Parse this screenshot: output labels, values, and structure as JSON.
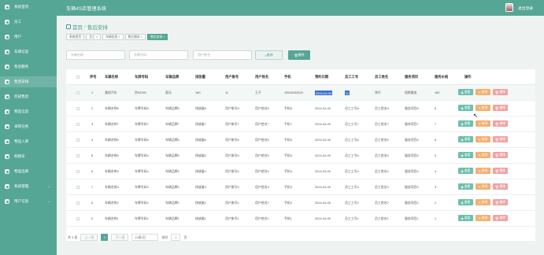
{
  "app": {
    "title": "车辆4S店管理系统",
    "logout": "退出登录"
  },
  "sidebar": {
    "items": [
      {
        "label": "系统首页"
      },
      {
        "label": "员工"
      },
      {
        "label": "用户"
      },
      {
        "label": "车辆信息"
      },
      {
        "label": "售后服务"
      },
      {
        "label": "售后安排"
      },
      {
        "label": "完成售后"
      },
      {
        "label": "物品信息"
      },
      {
        "label": "采购任务"
      },
      {
        "label": "物品入库"
      },
      {
        "label": "购物车"
      },
      {
        "label": "物品出库"
      },
      {
        "label": "系统管理"
      },
      {
        "label": "用户信息"
      }
    ],
    "active_index": 5
  },
  "page": {
    "breadcrumb_home": "首页",
    "breadcrumb_sep": "/",
    "breadcrumb_current": "售后安排",
    "tabs": [
      {
        "label": "系统首页"
      },
      {
        "label": "员工 ×"
      },
      {
        "label": "车辆信息 ×"
      },
      {
        "label": "售后服务 ×"
      },
      {
        "label": "售后安排 ×"
      }
    ]
  },
  "search": {
    "vehicle_name_placeholder": "车辆名称",
    "vehicle_no_placeholder": "车牌号码",
    "user_name_placeholder": "用户姓名",
    "search_label": "查询",
    "delete_label": "删除"
  },
  "table": {
    "headers": [
      "序号",
      "车辆名称",
      "车牌号码",
      "车辆品牌",
      "排放量",
      "用户账号",
      "用户姓名",
      "手机",
      "预约日期",
      "员工工号",
      "员工姓名",
      "服务项目",
      "服务价格",
      "操作"
    ],
    "rows": [
      [
        "1",
        "我的汽车",
        "京52255",
        "奥马",
        "180",
        "11",
        "王子",
        "13525252525",
        "2024-04-09",
        "11",
        "李仔",
        "保养服务",
        "180"
      ],
      [
        "2",
        "车辆名称8",
        "车牌号码8",
        "车辆品牌8",
        "排放量8",
        "用户账号8",
        "用户姓名8",
        "手机8",
        "2024-04-09",
        "员工工号8",
        "员工姓名8",
        "服务项目8",
        "8"
      ],
      [
        "3",
        "车辆名称7",
        "车牌号码7",
        "车辆品牌7",
        "排放量7",
        "用户账号7",
        "用户姓名7",
        "手机7",
        "2024-04-09",
        "员工工号7",
        "员工姓名7",
        "服务项目7",
        "7"
      ],
      [
        "4",
        "车辆名称6",
        "车牌号码6",
        "车辆品牌6",
        "排放量6",
        "用户账号6",
        "用户姓名6",
        "手机6",
        "2024-04-09",
        "员工工号6",
        "员工姓名6",
        "服务项目6",
        "6"
      ],
      [
        "5",
        "车辆名称5",
        "车牌号码5",
        "车辆品牌5",
        "排放量5",
        "用户账号5",
        "用户姓名5",
        "手机5",
        "2024-04-09",
        "员工工号5",
        "员工姓名5",
        "服务项目5",
        "5"
      ],
      [
        "6",
        "车辆名称4",
        "车牌号码4",
        "车辆品牌4",
        "排放量4",
        "用户账号4",
        "用户姓名4",
        "手机4",
        "2024-04-09",
        "员工工号4",
        "员工姓名4",
        "服务项目4",
        "4"
      ],
      [
        "7",
        "车辆名称3",
        "车牌号码3",
        "车辆品牌3",
        "排放量3",
        "用户账号3",
        "用户姓名3",
        "手机3",
        "2024-04-09",
        "员工工号3",
        "员工姓名3",
        "服务项目3",
        "3"
      ],
      [
        "8",
        "车辆名称2",
        "车牌号码2",
        "车辆品牌2",
        "排放量2",
        "用户账号2",
        "用户姓名2",
        "手机2",
        "2024-04-09",
        "员工工号2",
        "员工姓名2",
        "服务项目2",
        "2"
      ],
      [
        "9",
        "车辆名称1",
        "车牌号码1",
        "车辆品牌1",
        "排放量1",
        "用户账号1",
        "用户姓名1",
        "手机1",
        "2024-04-09",
        "员工工号1",
        "员工姓名1",
        "服务项目1",
        "1"
      ]
    ],
    "actions": {
      "view": "查看",
      "edit": "修改",
      "del": "删除"
    }
  },
  "pagination": {
    "total": "共 9 条",
    "prev": "上一页",
    "page": "1",
    "next": "下一页",
    "page_size": "10条/页",
    "goto_prefix": "前往",
    "goto_value": "1",
    "goto_suffix": "页"
  },
  "colors": {
    "theme": "#56a695",
    "view": "#6ebfae",
    "edit": "#f2b171",
    "delete": "#f0a3a3",
    "selection": "#3b73d6"
  },
  "icons": {
    "home": "home-icon",
    "search": "search-icon",
    "trash": "trash-icon",
    "avatar": "avatar"
  }
}
